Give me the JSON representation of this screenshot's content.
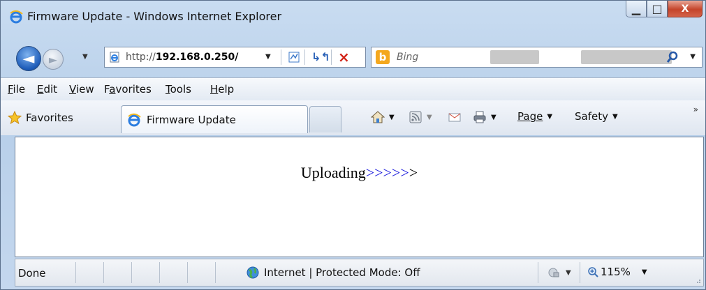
{
  "window": {
    "title": "Firmware Update - Windows Internet Explorer",
    "minimize_glyph": "▁",
    "maximize_glyph": "□",
    "close_glyph": "X"
  },
  "nav": {
    "back_glyph": "◄",
    "forward_glyph": "►",
    "address_prefix": "http://",
    "address_host": "192.168.0.250/",
    "search_placeholder": "Bing",
    "bing_logo_letter": "b"
  },
  "menu": {
    "items": [
      {
        "pre": "",
        "key": "F",
        "post": "ile"
      },
      {
        "pre": "",
        "key": "E",
        "post": "dit"
      },
      {
        "pre": "",
        "key": "V",
        "post": "iew"
      },
      {
        "pre": "F",
        "key": "a",
        "post": "vorites"
      },
      {
        "pre": "",
        "key": "T",
        "post": "ools"
      },
      {
        "pre": "",
        "key": "H",
        "post": "elp"
      }
    ]
  },
  "command_bar": {
    "favorites_label": "Favorites",
    "tab_label": "Firmware Update",
    "page_label": "Page",
    "safety_label": "Safety",
    "chevrons": "»"
  },
  "content": {
    "upload_text": "Uploading",
    "upload_arrows": ">>>>>",
    "upload_tail": ">"
  },
  "status": {
    "text": "Done",
    "zone": "Internet | Protected Mode: Off",
    "zoom": "115%"
  },
  "colors": {
    "arrows": "#1a1adc",
    "close_button": "#c4442a",
    "frame": "#b7cfe9"
  },
  "icons": [
    "ie-logo-icon",
    "back-icon",
    "forward-icon",
    "page-icon",
    "compatibility-icon",
    "refresh-icon",
    "stop-icon",
    "bing-icon",
    "search-icon",
    "star-icon",
    "home-icon",
    "feeds-icon",
    "mail-icon",
    "print-icon",
    "globe-icon",
    "protected-mode-icon",
    "zoom-icon"
  ]
}
